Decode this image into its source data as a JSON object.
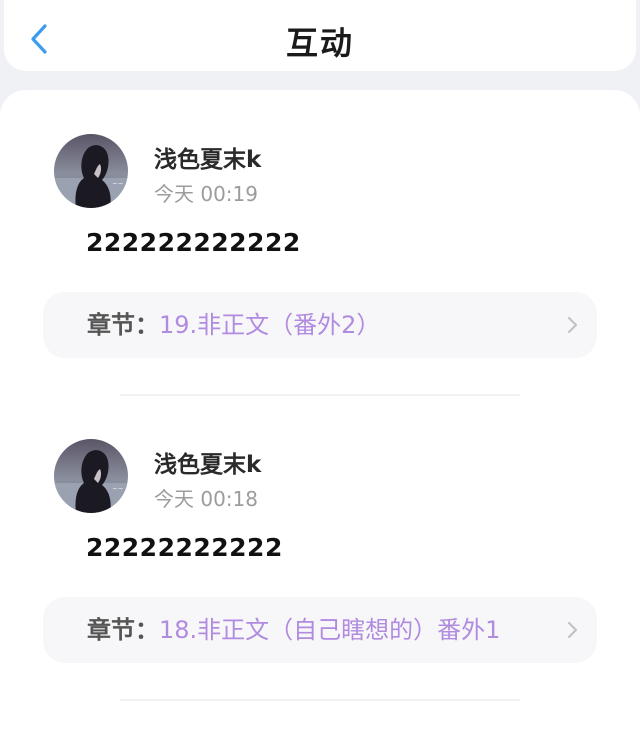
{
  "header": {
    "title": "互动"
  },
  "comments": [
    {
      "username": "浅色夏末k",
      "time": "今天 00:19",
      "content": "222222222222",
      "chapter_label": "章节：",
      "chapter_name": "19.非正文（番外2）"
    },
    {
      "username": "浅色夏末k",
      "time": "今天 00:18",
      "content": "22222222222",
      "chapter_label": "章节：",
      "chapter_name": "18.非正文（自己瞎想的）番外1"
    }
  ],
  "colors": {
    "accent_back": "#3b9bef",
    "chapter_link": "#b08be0",
    "page_background": "#f0f1f5"
  },
  "icons": {
    "back": "chevron-left-icon",
    "chapter_arrow": "chevron-right-icon"
  }
}
